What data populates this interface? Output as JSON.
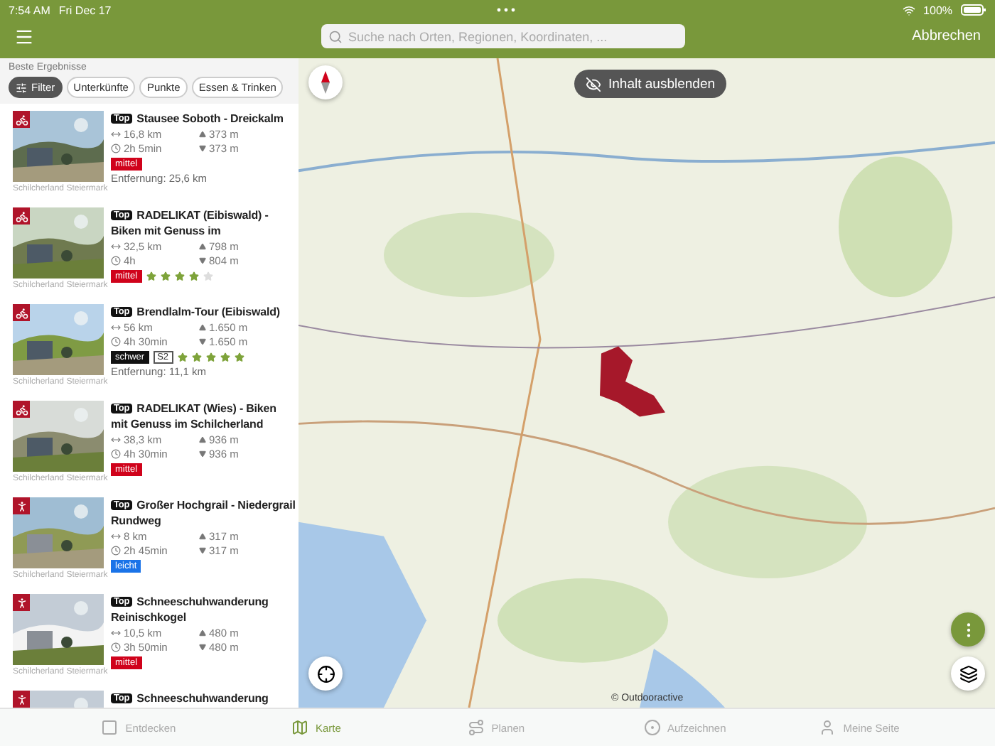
{
  "status_bar": {
    "time": "7:54 AM",
    "date": "Fri Dec 17",
    "battery": "100%"
  },
  "toolbar": {
    "search": {
      "placeholder": "Suche nach Orten, Regionen, Koordinaten, ..."
    },
    "cancel": "Abbrechen"
  },
  "results": {
    "heading": "Beste Ergebnisse",
    "chips": [
      {
        "label": "Filter",
        "selected": true
      },
      {
        "label": "Unterkünfte",
        "selected": false
      },
      {
        "label": "Punkte",
        "selected": false
      },
      {
        "label": "Essen & Trinken",
        "selected": false
      }
    ],
    "items": [
      {
        "kind": "bike",
        "badge": "Top",
        "title": "Stausee Soboth - Dreickalm",
        "length": "16,8 km",
        "duration": "2h 5min",
        "ascent": "373 m",
        "descent": "373 m",
        "difficulty": "mittel",
        "color": "#d0021b",
        "distance": "Entfernung: 25,6 km",
        "region": "Schilcherland Steiermark"
      },
      {
        "kind": "bike",
        "badge": "Top",
        "title": "RADELIKAT (Eibiswald) - Biken mit Genuss im",
        "length": "32,5 km",
        "duration": "4h",
        "ascent": "798 m",
        "descent": "804 m",
        "difficulty": "mittel",
        "color": "#d0021b",
        "stars": 4,
        "region": "Schilcherland Steiermark"
      },
      {
        "kind": "bike",
        "badge": "Top",
        "title": "Brendlalm-Tour (Eibiswald)",
        "length": "56 km",
        "duration": "4h 30min",
        "ascent": "1.650 m",
        "descent": "1.650 m",
        "difficulty": "schwer",
        "color": "#111111",
        "scale": "S2",
        "stars": 5,
        "distance": "Entfernung: 11,1 km",
        "region": "Schilcherland Steiermark"
      },
      {
        "kind": "bike",
        "badge": "Top",
        "title": "RADELIKAT (Wies) - Biken mit Genuss im Schilcherland",
        "length": "38,3 km",
        "duration": "4h 30min",
        "ascent": "936 m",
        "descent": "936 m",
        "difficulty": "mittel",
        "color": "#d0021b",
        "region": "Schilcherland Steiermark"
      },
      {
        "kind": "hike",
        "badge": "Top",
        "title": "Großer Hochgrail - Niedergrail Rundweg",
        "length": "8 km",
        "duration": "2h 45min",
        "ascent": "317 m",
        "descent": "317 m",
        "difficulty": "leicht",
        "color": "#1a73e8",
        "region": "Schilcherland Steiermark"
      },
      {
        "kind": "hike",
        "badge": "Top",
        "title": "Schneeschuhwanderung Reinischkogel",
        "length": "10,5 km",
        "duration": "3h 50min",
        "ascent": "480 m",
        "descent": "480 m",
        "difficulty": "mittel",
        "color": "#d0021b",
        "region": "Schilcherland Steiermark"
      },
      {
        "kind": "hike",
        "badge": "Top",
        "title": "Schneeschuhwanderung"
      }
    ]
  },
  "map": {
    "hide_button": "Inhalt ausblenden",
    "attribution": "© Outdooractive"
  },
  "tab_bar": [
    {
      "label": "Entdecken",
      "selected": false
    },
    {
      "label": "Karte",
      "selected": true
    },
    {
      "label": "Planen",
      "selected": false
    },
    {
      "label": "Aufzeichnen",
      "selected": false
    },
    {
      "label": "Meine Seite",
      "selected": false
    }
  ]
}
